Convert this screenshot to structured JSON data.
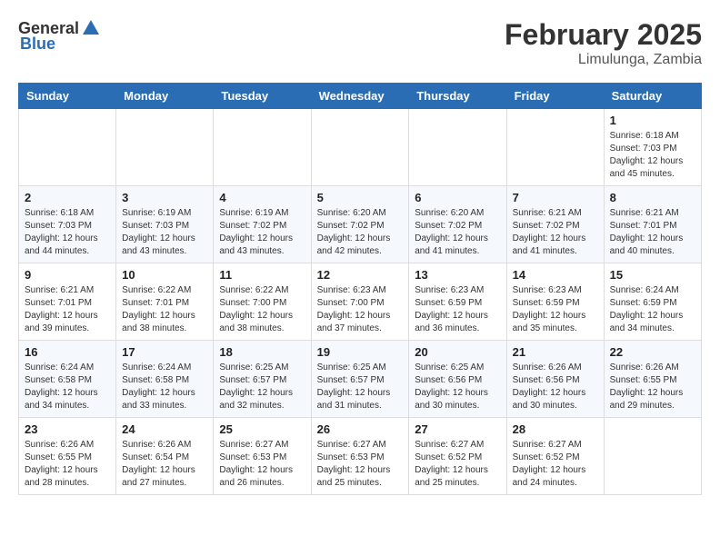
{
  "logo": {
    "general": "General",
    "blue": "Blue"
  },
  "title": "February 2025",
  "location": "Limulunga, Zambia",
  "weekdays": [
    "Sunday",
    "Monday",
    "Tuesday",
    "Wednesday",
    "Thursday",
    "Friday",
    "Saturday"
  ],
  "weeks": [
    [
      {
        "day": "",
        "info": ""
      },
      {
        "day": "",
        "info": ""
      },
      {
        "day": "",
        "info": ""
      },
      {
        "day": "",
        "info": ""
      },
      {
        "day": "",
        "info": ""
      },
      {
        "day": "",
        "info": ""
      },
      {
        "day": "1",
        "info": "Sunrise: 6:18 AM\nSunset: 7:03 PM\nDaylight: 12 hours and 45 minutes."
      }
    ],
    [
      {
        "day": "2",
        "info": "Sunrise: 6:18 AM\nSunset: 7:03 PM\nDaylight: 12 hours and 44 minutes."
      },
      {
        "day": "3",
        "info": "Sunrise: 6:19 AM\nSunset: 7:03 PM\nDaylight: 12 hours and 43 minutes."
      },
      {
        "day": "4",
        "info": "Sunrise: 6:19 AM\nSunset: 7:02 PM\nDaylight: 12 hours and 43 minutes."
      },
      {
        "day": "5",
        "info": "Sunrise: 6:20 AM\nSunset: 7:02 PM\nDaylight: 12 hours and 42 minutes."
      },
      {
        "day": "6",
        "info": "Sunrise: 6:20 AM\nSunset: 7:02 PM\nDaylight: 12 hours and 41 minutes."
      },
      {
        "day": "7",
        "info": "Sunrise: 6:21 AM\nSunset: 7:02 PM\nDaylight: 12 hours and 41 minutes."
      },
      {
        "day": "8",
        "info": "Sunrise: 6:21 AM\nSunset: 7:01 PM\nDaylight: 12 hours and 40 minutes."
      }
    ],
    [
      {
        "day": "9",
        "info": "Sunrise: 6:21 AM\nSunset: 7:01 PM\nDaylight: 12 hours and 39 minutes."
      },
      {
        "day": "10",
        "info": "Sunrise: 6:22 AM\nSunset: 7:01 PM\nDaylight: 12 hours and 38 minutes."
      },
      {
        "day": "11",
        "info": "Sunrise: 6:22 AM\nSunset: 7:00 PM\nDaylight: 12 hours and 38 minutes."
      },
      {
        "day": "12",
        "info": "Sunrise: 6:23 AM\nSunset: 7:00 PM\nDaylight: 12 hours and 37 minutes."
      },
      {
        "day": "13",
        "info": "Sunrise: 6:23 AM\nSunset: 6:59 PM\nDaylight: 12 hours and 36 minutes."
      },
      {
        "day": "14",
        "info": "Sunrise: 6:23 AM\nSunset: 6:59 PM\nDaylight: 12 hours and 35 minutes."
      },
      {
        "day": "15",
        "info": "Sunrise: 6:24 AM\nSunset: 6:59 PM\nDaylight: 12 hours and 34 minutes."
      }
    ],
    [
      {
        "day": "16",
        "info": "Sunrise: 6:24 AM\nSunset: 6:58 PM\nDaylight: 12 hours and 34 minutes."
      },
      {
        "day": "17",
        "info": "Sunrise: 6:24 AM\nSunset: 6:58 PM\nDaylight: 12 hours and 33 minutes."
      },
      {
        "day": "18",
        "info": "Sunrise: 6:25 AM\nSunset: 6:57 PM\nDaylight: 12 hours and 32 minutes."
      },
      {
        "day": "19",
        "info": "Sunrise: 6:25 AM\nSunset: 6:57 PM\nDaylight: 12 hours and 31 minutes."
      },
      {
        "day": "20",
        "info": "Sunrise: 6:25 AM\nSunset: 6:56 PM\nDaylight: 12 hours and 30 minutes."
      },
      {
        "day": "21",
        "info": "Sunrise: 6:26 AM\nSunset: 6:56 PM\nDaylight: 12 hours and 30 minutes."
      },
      {
        "day": "22",
        "info": "Sunrise: 6:26 AM\nSunset: 6:55 PM\nDaylight: 12 hours and 29 minutes."
      }
    ],
    [
      {
        "day": "23",
        "info": "Sunrise: 6:26 AM\nSunset: 6:55 PM\nDaylight: 12 hours and 28 minutes."
      },
      {
        "day": "24",
        "info": "Sunrise: 6:26 AM\nSunset: 6:54 PM\nDaylight: 12 hours and 27 minutes."
      },
      {
        "day": "25",
        "info": "Sunrise: 6:27 AM\nSunset: 6:53 PM\nDaylight: 12 hours and 26 minutes."
      },
      {
        "day": "26",
        "info": "Sunrise: 6:27 AM\nSunset: 6:53 PM\nDaylight: 12 hours and 25 minutes."
      },
      {
        "day": "27",
        "info": "Sunrise: 6:27 AM\nSunset: 6:52 PM\nDaylight: 12 hours and 25 minutes."
      },
      {
        "day": "28",
        "info": "Sunrise: 6:27 AM\nSunset: 6:52 PM\nDaylight: 12 hours and 24 minutes."
      },
      {
        "day": "",
        "info": ""
      }
    ]
  ]
}
